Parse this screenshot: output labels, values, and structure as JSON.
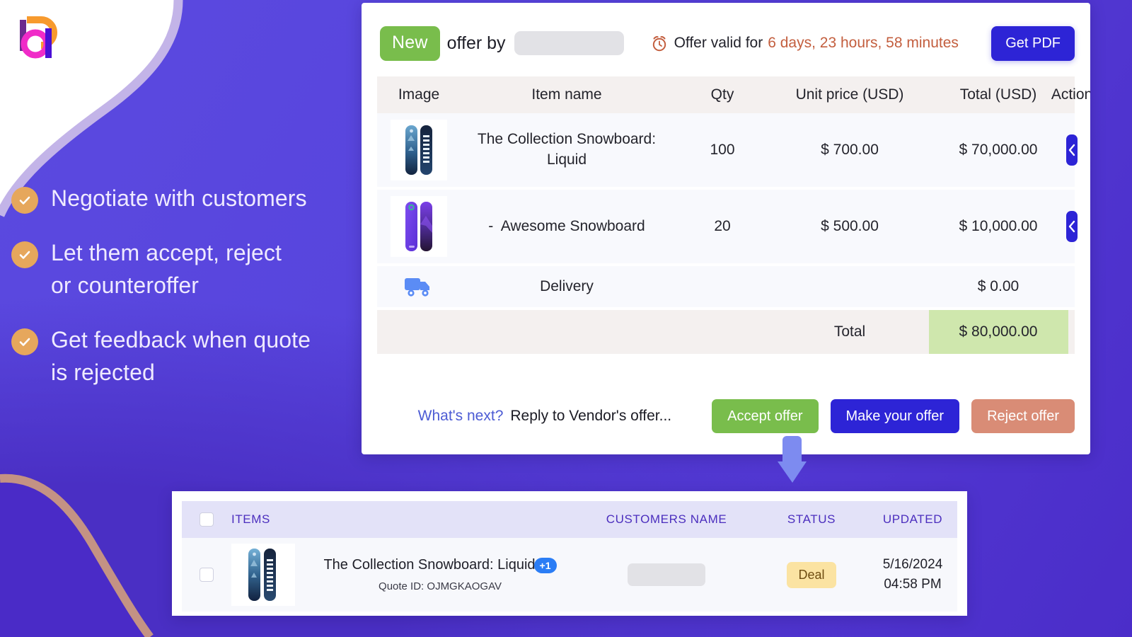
{
  "brand": {
    "logo_name": "company-logo",
    "accent_purple": "#5645d8",
    "accent_blue": "#2d24d6",
    "accent_green": "#79bd4c",
    "accent_orange": "#e6a75c"
  },
  "features": [
    {
      "icon": "check-circle-icon",
      "text": "Negotiate with customers"
    },
    {
      "icon": "check-circle-icon",
      "text": "Let them accept, reject\nor counteroffer"
    },
    {
      "icon": "check-circle-icon",
      "text": "Get feedback when quote\nis rejected"
    }
  ],
  "offer": {
    "badge": "New",
    "by_label": "offer by",
    "vendor_value": "",
    "clock_icon": "alarm-clock-icon",
    "valid_label": "Offer valid for",
    "valid_time": "6 days, 23 hours, 58 minutes",
    "get_pdf_label": "Get PDF",
    "columns": [
      "Image",
      "Item name",
      "Qty",
      "Unit price (USD)",
      "Total (USD)",
      "Action"
    ],
    "rows": [
      {
        "image_alt": "snowboard-liquid-thumbnail",
        "name": "The Collection Snowboard: Liquid",
        "qty": "100",
        "unit_price": "$ 700.00",
        "total": "$ 70,000.00",
        "action_icon": "chevron-left-icon"
      },
      {
        "image_alt": "snowboard-purple-thumbnail",
        "name": "-  Awesome Snowboard",
        "qty": "20",
        "unit_price": "$ 500.00",
        "total": "$ 10,000.00",
        "action_icon": "chevron-left-icon"
      }
    ],
    "delivery": {
      "icon": "delivery-truck-icon",
      "label": "Delivery",
      "total": "$ 0.00"
    },
    "summary": {
      "label": "Total",
      "value": "$ 80,000.00",
      "highlight_color": "#cfe7ad"
    },
    "cta": {
      "whats_next": "What's next?",
      "reply_text": "Reply to Vendor's offer...",
      "accept_label": "Accept offer",
      "make_label": "Make your offer",
      "reject_label": "Reject offer"
    }
  },
  "arrow": {
    "icon": "arrow-down-icon",
    "color": "#7d8bf0"
  },
  "quotes_list": {
    "columns": [
      "",
      "ITEMS",
      "CUSTOMERS NAME",
      "STATUS",
      "UPDATED"
    ],
    "rows": [
      {
        "image_alt": "snowboard-liquid-thumbnail",
        "item_title": "The Collection Snowboard: Liquid",
        "extra_count": "+1",
        "quote_id": "Quote ID: OJMGKAOGAV",
        "customer_name": "",
        "status": "Deal",
        "updated_date": "5/16/2024",
        "updated_time": "04:58 PM"
      }
    ]
  }
}
